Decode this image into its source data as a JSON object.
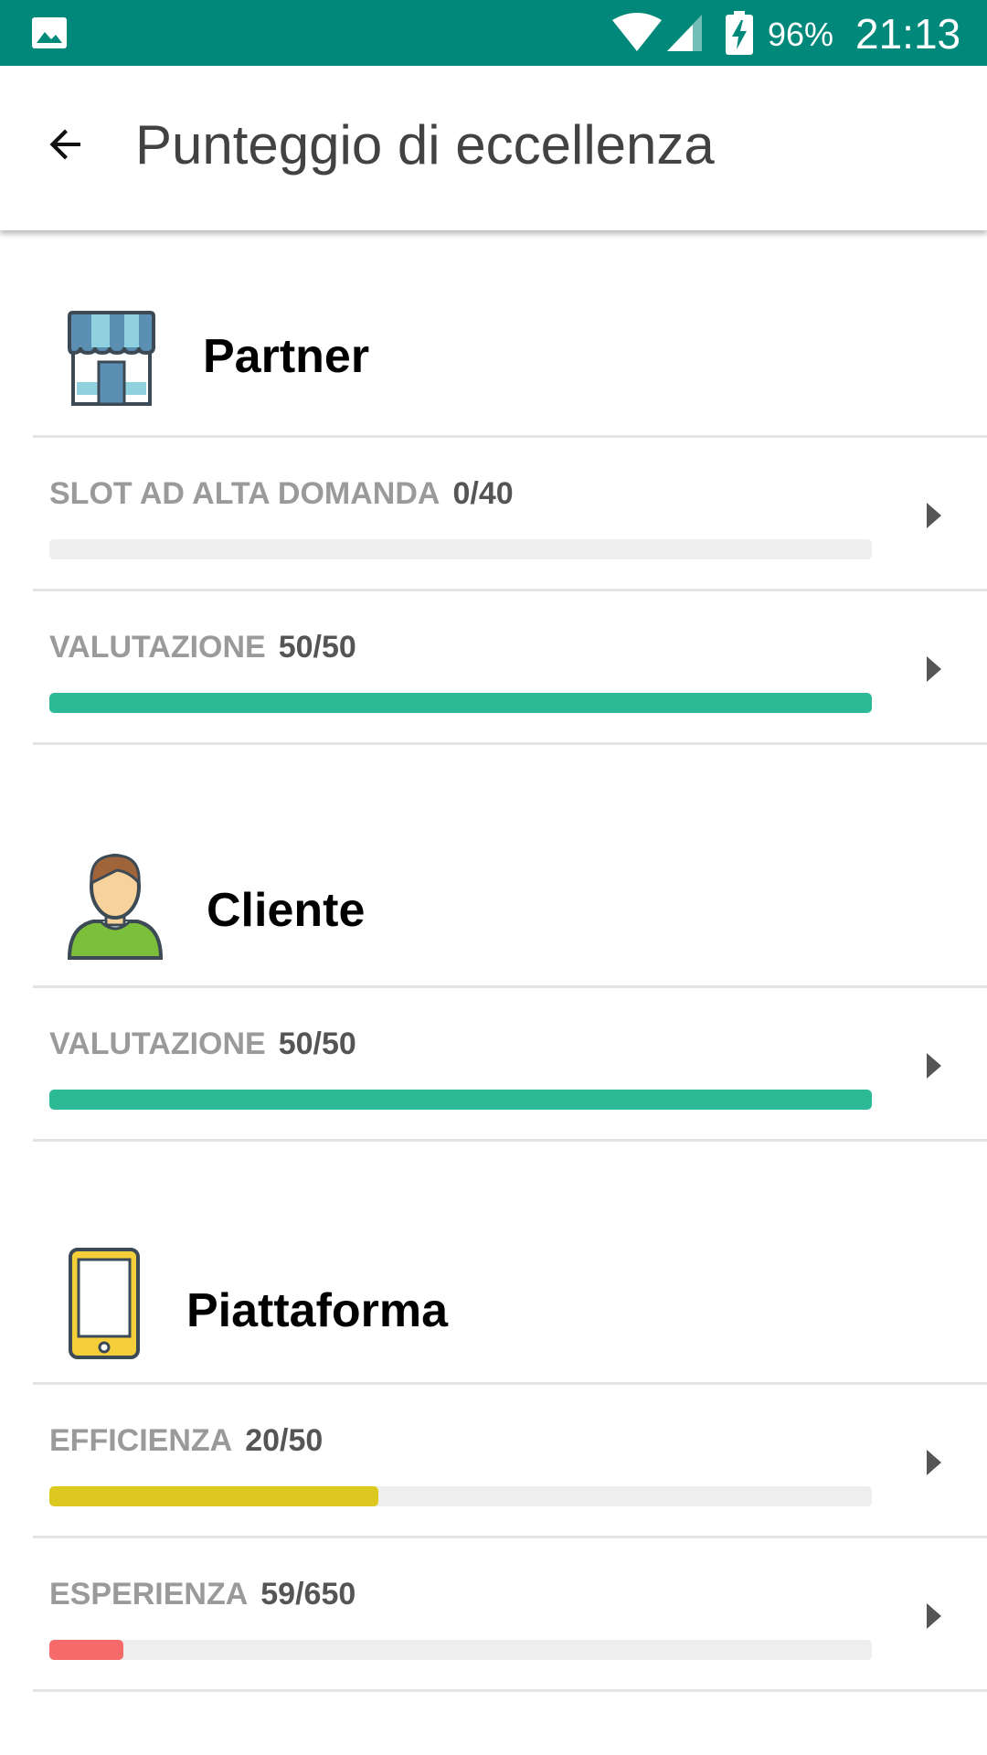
{
  "status_bar": {
    "battery": "96%",
    "time": "21:13",
    "icons": [
      "gallery-icon",
      "wifi-icon",
      "signal-icon",
      "battery-charging-icon"
    ]
  },
  "app_bar": {
    "title": "Punteggio di eccellenza",
    "back_icon": "arrow-back-icon"
  },
  "colors": {
    "status_bar": "#00897b",
    "green": "#2bb996",
    "yellow": "#dcc81e",
    "red": "#f76a6a",
    "track": "#eeeeee"
  },
  "sections": [
    {
      "title": "Partner",
      "icon": "store-icon",
      "metrics": [
        {
          "label": "SLOT AD ALTA DOMANDA",
          "value": "0/40",
          "progress": 0.0,
          "color": "#2bb996"
        },
        {
          "label": "VALUTAZIONE",
          "value": "50/50",
          "progress": 1.0,
          "color": "#2bb996"
        }
      ]
    },
    {
      "title": "Cliente",
      "icon": "customer-icon",
      "metrics": [
        {
          "label": "VALUTAZIONE",
          "value": "50/50",
          "progress": 1.0,
          "color": "#2bb996"
        }
      ]
    },
    {
      "title": "Piattaforma",
      "icon": "smartphone-icon",
      "metrics": [
        {
          "label": "EFFICIENZA",
          "value": "20/50",
          "progress": 0.4,
          "color": "#dcc81e"
        },
        {
          "label": "ESPERIENZA",
          "value": "59/650",
          "progress": 0.09,
          "color": "#f76a6a"
        }
      ]
    }
  ]
}
